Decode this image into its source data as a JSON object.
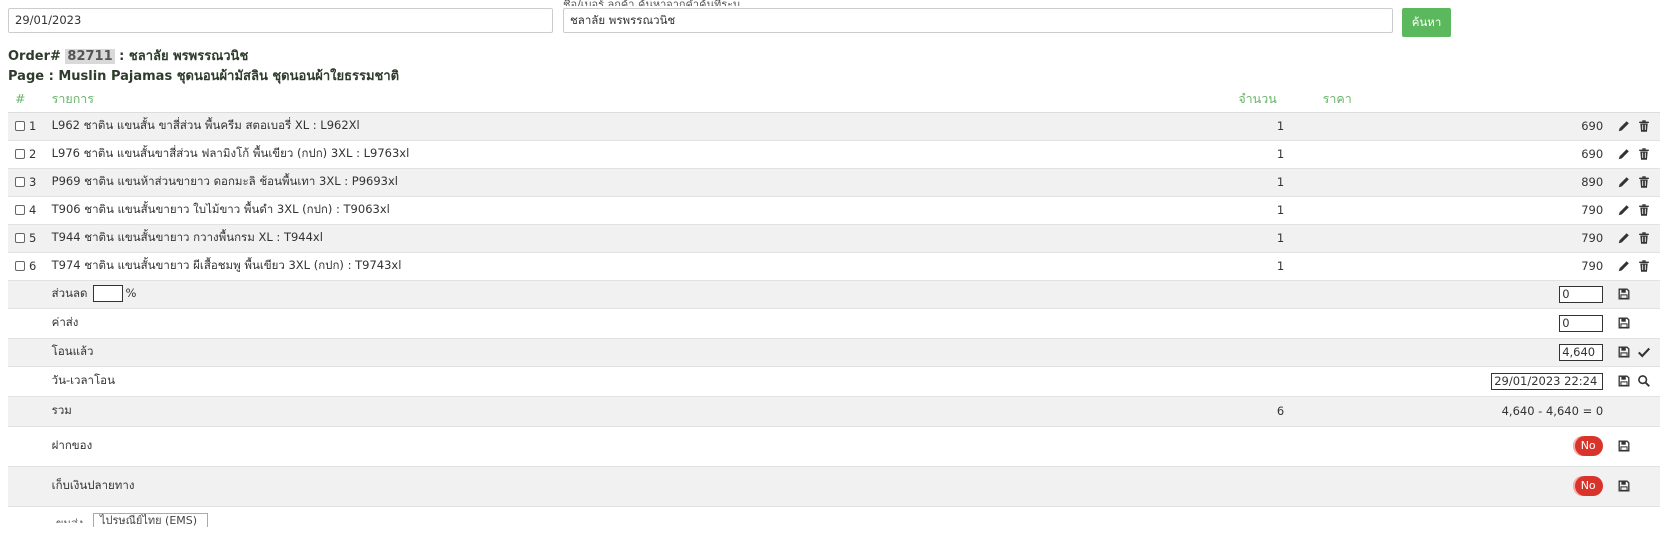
{
  "search": {
    "date_value": "29/01/2023",
    "name_value": "ชลาลัย พรพรรณวนิช",
    "button_label": "ค้นหา",
    "cut_label": "ชื่อ/เบอร์ ลูกค้า ค้นหาจากคำค้นที่ระบุ"
  },
  "order": {
    "prefix": "Order#",
    "number": "82711",
    "customer": " : ชลาลัย พรพรรณวนิช",
    "page_line": "Page : Muslin Pajamas ชุดนอนผ้ามัสลิน ชุดนอนผ้าใยธรรมชาติ"
  },
  "table": {
    "headers": {
      "num": "#",
      "name": "รายการ",
      "qty": "จำนวน",
      "price": "ราคา"
    },
    "rows": [
      {
        "num": "1",
        "name": "L962 ชาติน แขนสั้น ขาสี่ส่วน พื้นครีม สตอเบอรี่ XL : L962Xl",
        "qty": "1",
        "price": "690"
      },
      {
        "num": "2",
        "name": "L976 ชาติน แขนสั้นขาสี่ส่วน ฟลามิงโก้ พื้นเขียว (กปก) 3XL : L9763xl",
        "qty": "1",
        "price": "690"
      },
      {
        "num": "3",
        "name": "P969 ชาติน แขนห้าส่วนขายาว ดอกมะลิ ช้อนพื้นเทา 3XL : P9693xl",
        "qty": "1",
        "price": "890"
      },
      {
        "num": "4",
        "name": "T906 ชาติน แขนสั้นขายาว ใบไม้ขาว พื้นดำ 3XL (กปก) : T9063xl",
        "qty": "1",
        "price": "790"
      },
      {
        "num": "5",
        "name": "T944 ชาติน แขนสั้นขายาว กวางพื้นกรม XL : T944xl",
        "qty": "1",
        "price": "790"
      },
      {
        "num": "6",
        "name": "T974 ชาติน แขนสั้นขายาว ผีเสื้อชมพู พื้นเขียว 3XL (กปก) : T9743xl",
        "qty": "1",
        "price": "790"
      }
    ],
    "discount": {
      "label": "ส่วนลด",
      "percent_value": "",
      "percent_sign": "%",
      "amount": "0"
    },
    "shipping": {
      "label": "ค่าส่ง",
      "value": "0"
    },
    "paid": {
      "label": "โอนแล้ว",
      "value": "4,640"
    },
    "transfer_time": {
      "label": "วัน-เวลาโอน",
      "value": "29/01/2023 22:24"
    },
    "total": {
      "label": "รวม",
      "qty": "6",
      "value": "4,640 - 4,640 = 0"
    },
    "deposit": {
      "label": "ฝากของ",
      "toggle": "No"
    },
    "cod": {
      "label": "เก็บเงินปลายทาง",
      "toggle": "No"
    }
  },
  "bottom": {
    "label": "ขนส่ง",
    "select_value": "ไปรษณีย์ไทย (EMS)"
  },
  "icons": {
    "edit": "pencil-icon",
    "delete": "trash-icon",
    "save": "floppy-disk-icon",
    "confirm": "check-icon",
    "search": "search-icon"
  },
  "colors": {
    "accent": "#5cb85c",
    "header_text": "#6ab46a",
    "toggle_off": "#d9342b"
  }
}
